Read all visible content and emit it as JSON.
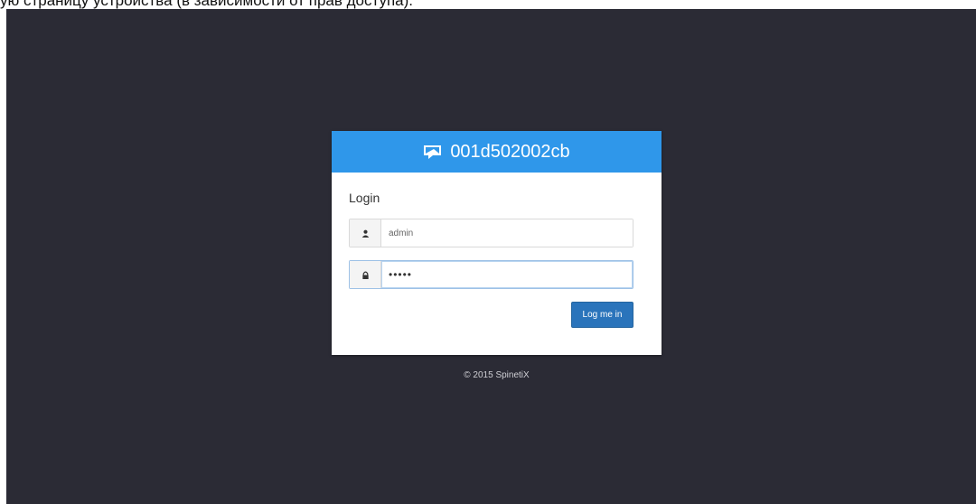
{
  "caption": "ую страницу устройства (в зависимости от прав доступа).",
  "header": {
    "icon": "device-monitor-icon",
    "title": "001d502002cb"
  },
  "form": {
    "title": "Login",
    "username": {
      "icon": "user-icon",
      "value": "admin"
    },
    "password": {
      "icon": "lock-icon",
      "value": "•••••"
    },
    "submit_label": "Log me in"
  },
  "footer": {
    "text": "© 2015 SpinetiX"
  },
  "colors": {
    "background": "#2b2b35",
    "header": "#2f97ea",
    "button": "#2a74bb"
  }
}
